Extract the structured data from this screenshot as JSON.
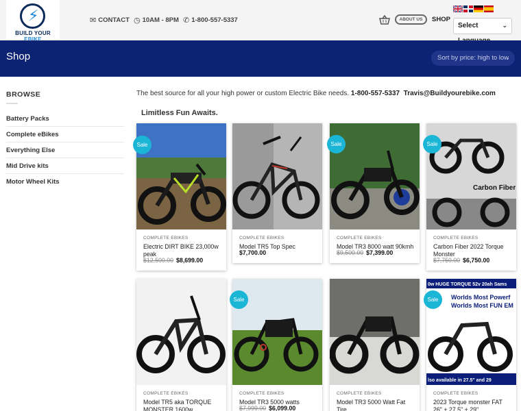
{
  "header": {
    "logo_text_1": "BUILD YOUR ",
    "logo_text_2": "EBIKE",
    "contact_label": "CONTACT",
    "hours_label": "10AM - 8PM",
    "phone_label": "1-800-557-5337",
    "about_label": "ABOUT US",
    "shop_label": "SHOP",
    "language_label": "Select Language"
  },
  "band": {
    "title": "Shop",
    "sort_label": "Sort by price: high to low"
  },
  "sidebar": {
    "heading": "BROWSE",
    "items": [
      "Battery Packs",
      "Complete eBikes",
      "Everything Else",
      "Mid Drive kits",
      "Motor Wheel Kits"
    ]
  },
  "main": {
    "intro_text": "The best source for all your high power or custom Electric Bike needs. ",
    "intro_phone": "1-800-557-5337",
    "intro_email": "Travis@Buildyourebike.com",
    "subheading": "Limitless Fun Awaits."
  },
  "sale_label": "Sale",
  "products": [
    {
      "category": "COMPLETE EBIKES",
      "title": "Electric DIRT BIKE 23,000w peak",
      "old_price": "$12,500.00",
      "price": "$8,699.00",
      "sale": true
    },
    {
      "category": "COMPLETE EBIKES",
      "title": "Model TR5 Top Spec",
      "old_price": "",
      "price": "$7,700.00",
      "sale": false
    },
    {
      "category": "COMPLETE EBIKES",
      "title": "Model TR3 8000 watt 90kmh",
      "old_price": "$9,500.00",
      "price": "$7,399.00",
      "sale": true
    },
    {
      "category": "COMPLETE EBIKES",
      "title": "Carbon Fiber 2022 Torque Monster",
      "old_price": "$7,750.00",
      "price": "$6,750.00",
      "sale": true,
      "image_text": "Carbon Fiber"
    },
    {
      "category": "COMPLETE EBIKES",
      "title": "Model TR5 aka TORQUE MONSTER 1600w",
      "old_price": "",
      "price": "",
      "sale": false
    },
    {
      "category": "COMPLETE EBIKES",
      "title": "Model TR3 5000 watts",
      "old_price": "$7,999.00",
      "price": "$6,099.00",
      "sale": true
    },
    {
      "category": "COMPLETE EBIKES",
      "title": "Model TR3 5000 Watt Fat Tire",
      "old_price": "",
      "price": "",
      "sale": false
    },
    {
      "category": "COMPLETE EBIKES",
      "title": "2023 Torque monster FAT 26\" + 27.5\" + 29\"",
      "old_price": "",
      "price": "",
      "sale": true,
      "image_text_top": "0w HUGE TORQUE 52v 20ah Sams",
      "image_text_2": "Worlds Most Powerf",
      "image_text_3": "Worlds Most FUN EM",
      "image_text_bottom": "lso available in 27.5\" and 29"
    }
  ],
  "colors": {
    "band": "#0c2273",
    "sale_badge": "#1bb5d6",
    "logo_blue": "#1e88d9"
  }
}
